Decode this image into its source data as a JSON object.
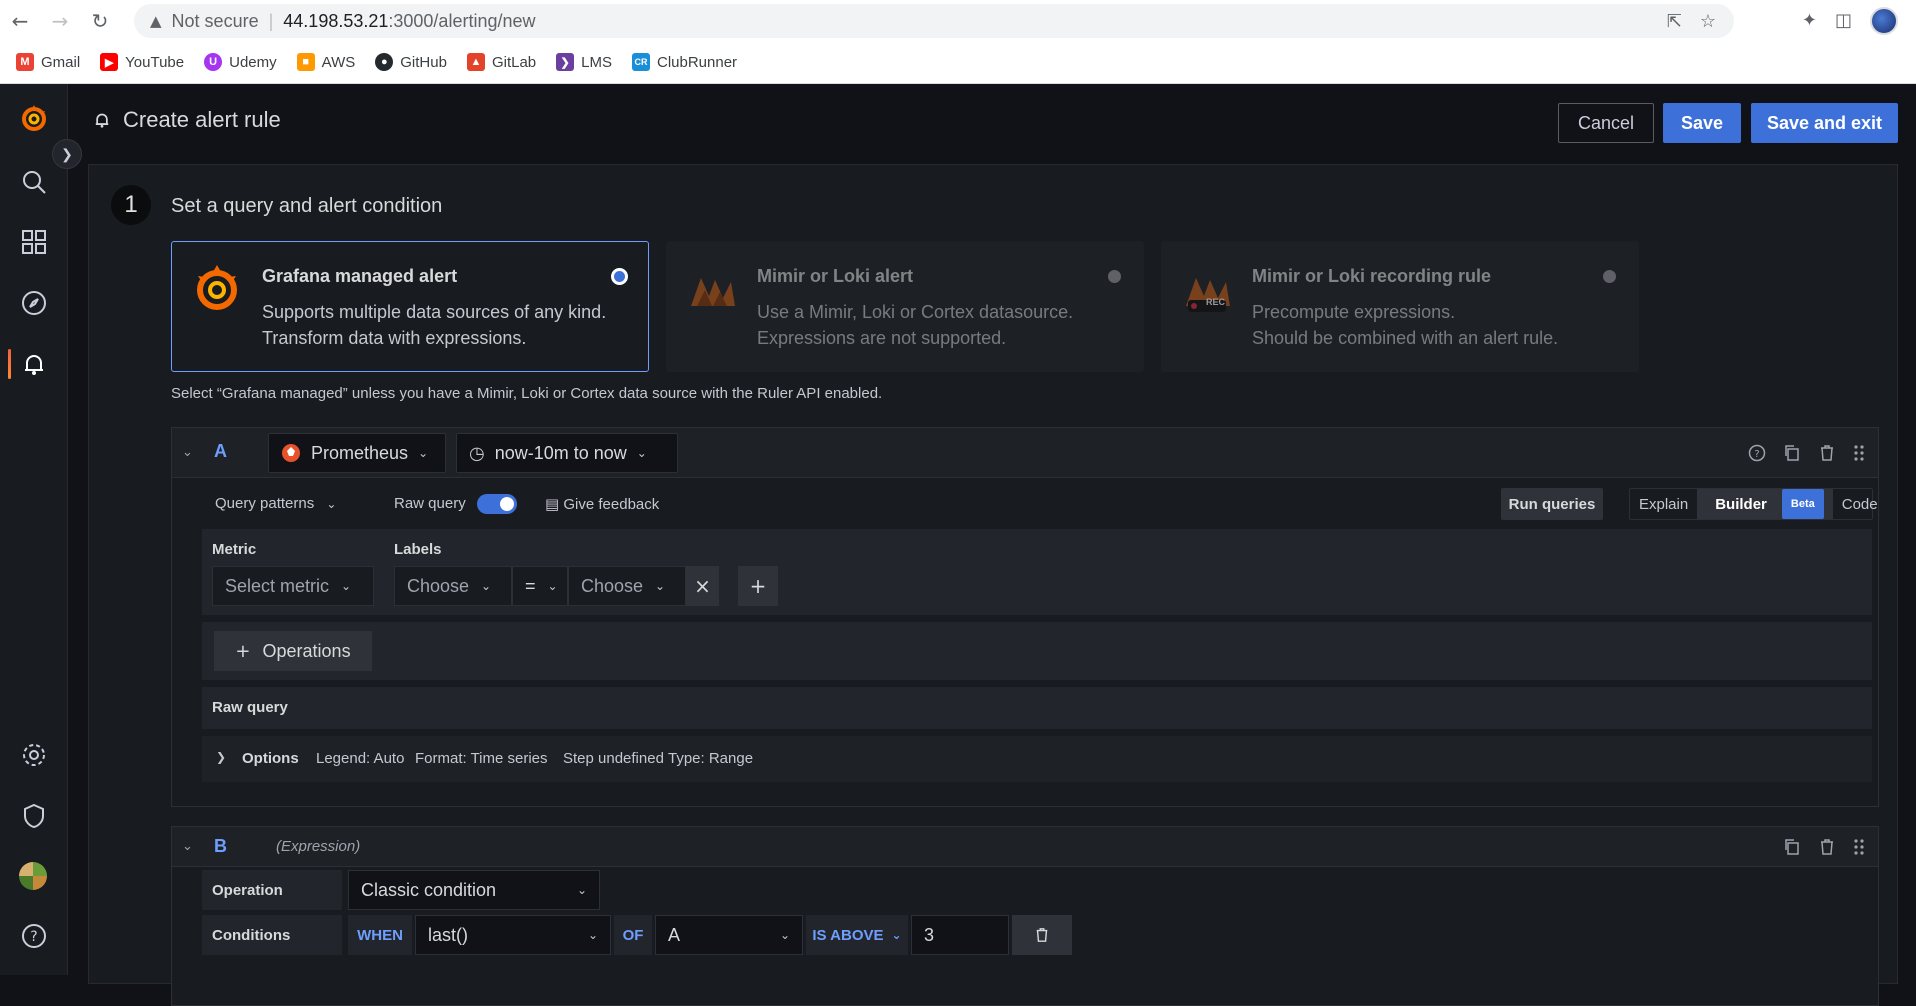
{
  "browser": {
    "not_secure": "Not secure",
    "url_host": "44.198.53.21",
    "url_path": ":3000/alerting/new",
    "bookmarks": [
      {
        "label": "Gmail",
        "icon": "gmail-icon",
        "color": "#ea4335"
      },
      {
        "label": "YouTube",
        "icon": "youtube-icon",
        "color": "#ff0000"
      },
      {
        "label": "Udemy",
        "icon": "udemy-icon",
        "color": "#a435f0"
      },
      {
        "label": "AWS",
        "icon": "aws-icon",
        "color": "#ff9900"
      },
      {
        "label": "GitHub",
        "icon": "github-icon",
        "color": "#24292e"
      },
      {
        "label": "GitLab",
        "icon": "gitlab-icon",
        "color": "#e24329"
      },
      {
        "label": "LMS",
        "icon": "lms-icon",
        "color": "#6b3fa0"
      },
      {
        "label": "ClubRunner",
        "icon": "clubrunner-icon",
        "color": "#1a8fd8"
      }
    ]
  },
  "header": {
    "title": "Create alert rule",
    "cancel": "Cancel",
    "save": "Save",
    "save_exit": "Save and exit"
  },
  "step": {
    "number": "1",
    "title": "Set a query and alert condition"
  },
  "cards": [
    {
      "title": "Grafana managed alert",
      "line1": "Supports multiple data sources of any kind.",
      "line2": "Transform data with expressions.",
      "selected": true
    },
    {
      "title": "Mimir or Loki alert",
      "line1": "Use a Mimir, Loki or Cortex datasource.",
      "line2": "Expressions are not supported.",
      "selected": false
    },
    {
      "title": "Mimir or Loki recording rule",
      "line1": "Precompute expressions.",
      "line2": "Should be combined with an alert rule.",
      "selected": false,
      "badge": "REC"
    }
  ],
  "hint": "Select “Grafana managed” unless you have a Mimir, Loki or Cortex data source with the Ruler API enabled.",
  "query_a": {
    "id": "A",
    "datasource": "Prometheus",
    "time_range": "now-10m to now",
    "query_patterns": "Query patterns",
    "raw_query_label": "Raw query",
    "feedback": "Give feedback",
    "run_queries": "Run queries",
    "modes": {
      "explain": "Explain",
      "builder": "Builder",
      "beta": "Beta",
      "code": "Code"
    },
    "metric_label": "Metric",
    "metric_placeholder": "Select metric",
    "labels_label": "Labels",
    "label_choose_1": "Choose",
    "label_op": "=",
    "label_choose_2": "Choose",
    "operations": "Operations",
    "raw_query_section": "Raw query",
    "options": {
      "label": "Options",
      "legend": "Legend: Auto",
      "format": "Format: Time series",
      "step": "Step undefined",
      "type": "Type: Range"
    }
  },
  "query_b": {
    "id": "B",
    "kind": "(Expression)",
    "operation_label": "Operation",
    "operation_value": "Classic condition",
    "conditions_label": "Conditions",
    "when": "WHEN",
    "reducer": "last()",
    "of": "OF",
    "query_ref": "A",
    "evaluator": "IS ABOVE",
    "threshold": "3"
  }
}
